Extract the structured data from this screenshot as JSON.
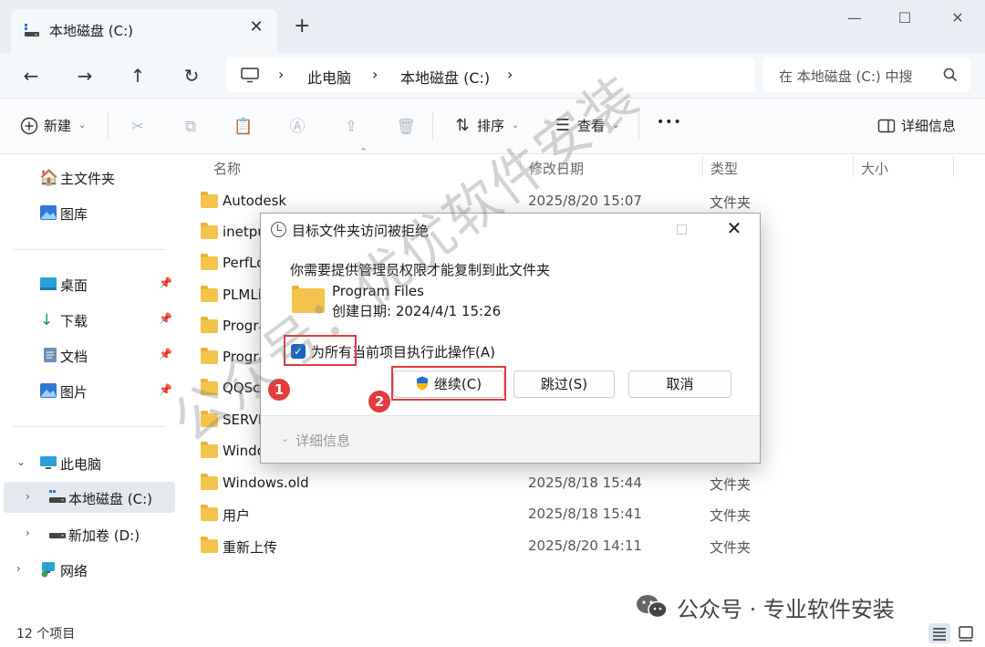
{
  "window": {
    "tab_title": "本地磁盘 (C:)",
    "new_tab_label": "+",
    "minimize_label": "—",
    "maximize_label": "☐",
    "close_label": "✕"
  },
  "address": {
    "root": "此电脑",
    "drive": "本地磁盘 (C:)",
    "search_placeholder": "在 本地磁盘 (C:) 中搜"
  },
  "toolbar": {
    "new_label": "新建",
    "sort_label": "排序",
    "view_label": "查看",
    "more_label": "•••",
    "details_label": "详细信息"
  },
  "sidebar": {
    "items": [
      {
        "label": "主文件夹"
      },
      {
        "label": "图库"
      },
      {
        "label": "桌面"
      },
      {
        "label": "下载"
      },
      {
        "label": "文档"
      },
      {
        "label": "图片"
      },
      {
        "label": "此电脑"
      },
      {
        "label": "本地磁盘 (C:)"
      },
      {
        "label": "新加卷 (D:)"
      },
      {
        "label": "网络"
      }
    ]
  },
  "columns": {
    "name": "名称",
    "modified": "修改日期",
    "type": "类型",
    "size": "大小"
  },
  "files": [
    {
      "name": "Autodesk",
      "date": "2025/8/20 15:07",
      "type": "文件夹"
    },
    {
      "name": "inetpub",
      "date": "",
      "type": ""
    },
    {
      "name": "PerfLogs",
      "date": "",
      "type": ""
    },
    {
      "name": "PLMLicense",
      "date": "",
      "type": ""
    },
    {
      "name": "Program Files",
      "date": "",
      "type": ""
    },
    {
      "name": "Program Files (x86)",
      "date": "",
      "type": ""
    },
    {
      "name": "QQScreenShot",
      "date": "",
      "type": ""
    },
    {
      "name": "SERVER",
      "date": "",
      "type": ""
    },
    {
      "name": "Windows",
      "date": "",
      "type": ""
    },
    {
      "name": "Windows.old",
      "date": "2025/8/18 15:44",
      "type": "文件夹"
    },
    {
      "name": "用户",
      "date": "2025/8/18 15:41",
      "type": "文件夹"
    },
    {
      "name": "重新上传",
      "date": "2025/8/20 14:11",
      "type": "文件夹"
    }
  ],
  "status": {
    "count_text": "12 个项目"
  },
  "dialog": {
    "title": "目标文件夹访问被拒绝",
    "message": "你需要提供管理员权限才能复制到此文件夹",
    "folder_name": "Program Files",
    "created": "创建日期: 2024/4/1 15:26",
    "checkbox_label": "为所有当前项目执行此操作(A)",
    "checkbox_checked": true,
    "continue_label": "继续(C)",
    "skip_label": "跳过(S)",
    "cancel_label": "取消",
    "details_label": "详细信息"
  },
  "annotations": {
    "marker1": "1",
    "marker2": "2",
    "accent": "#e23c3c"
  },
  "watermark": {
    "diagonal": "公众号：优优软件安装",
    "footer": "公众号 · 专业软件安装"
  }
}
